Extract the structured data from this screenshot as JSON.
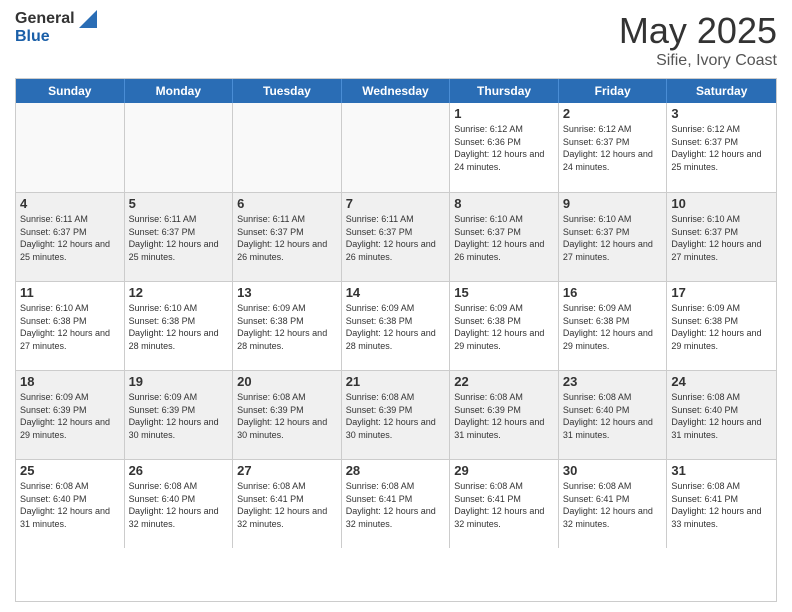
{
  "header": {
    "logo_general": "General",
    "logo_blue": "Blue",
    "month_title": "May 2025",
    "location": "Sifie, Ivory Coast"
  },
  "days_of_week": [
    "Sunday",
    "Monday",
    "Tuesday",
    "Wednesday",
    "Thursday",
    "Friday",
    "Saturday"
  ],
  "weeks": [
    [
      {
        "day": "",
        "empty": true
      },
      {
        "day": "",
        "empty": true
      },
      {
        "day": "",
        "empty": true
      },
      {
        "day": "",
        "empty": true
      },
      {
        "day": "1",
        "sunrise": "6:12 AM",
        "sunset": "6:36 PM",
        "daylight": "12 hours and 24 minutes."
      },
      {
        "day": "2",
        "sunrise": "6:12 AM",
        "sunset": "6:37 PM",
        "daylight": "12 hours and 24 minutes."
      },
      {
        "day": "3",
        "sunrise": "6:12 AM",
        "sunset": "6:37 PM",
        "daylight": "12 hours and 25 minutes."
      }
    ],
    [
      {
        "day": "4",
        "sunrise": "6:11 AM",
        "sunset": "6:37 PM",
        "daylight": "12 hours and 25 minutes."
      },
      {
        "day": "5",
        "sunrise": "6:11 AM",
        "sunset": "6:37 PM",
        "daylight": "12 hours and 25 minutes."
      },
      {
        "day": "6",
        "sunrise": "6:11 AM",
        "sunset": "6:37 PM",
        "daylight": "12 hours and 26 minutes."
      },
      {
        "day": "7",
        "sunrise": "6:11 AM",
        "sunset": "6:37 PM",
        "daylight": "12 hours and 26 minutes."
      },
      {
        "day": "8",
        "sunrise": "6:10 AM",
        "sunset": "6:37 PM",
        "daylight": "12 hours and 26 minutes."
      },
      {
        "day": "9",
        "sunrise": "6:10 AM",
        "sunset": "6:37 PM",
        "daylight": "12 hours and 27 minutes."
      },
      {
        "day": "10",
        "sunrise": "6:10 AM",
        "sunset": "6:37 PM",
        "daylight": "12 hours and 27 minutes."
      }
    ],
    [
      {
        "day": "11",
        "sunrise": "6:10 AM",
        "sunset": "6:38 PM",
        "daylight": "12 hours and 27 minutes."
      },
      {
        "day": "12",
        "sunrise": "6:10 AM",
        "sunset": "6:38 PM",
        "daylight": "12 hours and 28 minutes."
      },
      {
        "day": "13",
        "sunrise": "6:09 AM",
        "sunset": "6:38 PM",
        "daylight": "12 hours and 28 minutes."
      },
      {
        "day": "14",
        "sunrise": "6:09 AM",
        "sunset": "6:38 PM",
        "daylight": "12 hours and 28 minutes."
      },
      {
        "day": "15",
        "sunrise": "6:09 AM",
        "sunset": "6:38 PM",
        "daylight": "12 hours and 29 minutes."
      },
      {
        "day": "16",
        "sunrise": "6:09 AM",
        "sunset": "6:38 PM",
        "daylight": "12 hours and 29 minutes."
      },
      {
        "day": "17",
        "sunrise": "6:09 AM",
        "sunset": "6:38 PM",
        "daylight": "12 hours and 29 minutes."
      }
    ],
    [
      {
        "day": "18",
        "sunrise": "6:09 AM",
        "sunset": "6:39 PM",
        "daylight": "12 hours and 29 minutes."
      },
      {
        "day": "19",
        "sunrise": "6:09 AM",
        "sunset": "6:39 PM",
        "daylight": "12 hours and 30 minutes."
      },
      {
        "day": "20",
        "sunrise": "6:08 AM",
        "sunset": "6:39 PM",
        "daylight": "12 hours and 30 minutes."
      },
      {
        "day": "21",
        "sunrise": "6:08 AM",
        "sunset": "6:39 PM",
        "daylight": "12 hours and 30 minutes."
      },
      {
        "day": "22",
        "sunrise": "6:08 AM",
        "sunset": "6:39 PM",
        "daylight": "12 hours and 31 minutes."
      },
      {
        "day": "23",
        "sunrise": "6:08 AM",
        "sunset": "6:40 PM",
        "daylight": "12 hours and 31 minutes."
      },
      {
        "day": "24",
        "sunrise": "6:08 AM",
        "sunset": "6:40 PM",
        "daylight": "12 hours and 31 minutes."
      }
    ],
    [
      {
        "day": "25",
        "sunrise": "6:08 AM",
        "sunset": "6:40 PM",
        "daylight": "12 hours and 31 minutes."
      },
      {
        "day": "26",
        "sunrise": "6:08 AM",
        "sunset": "6:40 PM",
        "daylight": "12 hours and 32 minutes."
      },
      {
        "day": "27",
        "sunrise": "6:08 AM",
        "sunset": "6:41 PM",
        "daylight": "12 hours and 32 minutes."
      },
      {
        "day": "28",
        "sunrise": "6:08 AM",
        "sunset": "6:41 PM",
        "daylight": "12 hours and 32 minutes."
      },
      {
        "day": "29",
        "sunrise": "6:08 AM",
        "sunset": "6:41 PM",
        "daylight": "12 hours and 32 minutes."
      },
      {
        "day": "30",
        "sunrise": "6:08 AM",
        "sunset": "6:41 PM",
        "daylight": "12 hours and 32 minutes."
      },
      {
        "day": "31",
        "sunrise": "6:08 AM",
        "sunset": "6:41 PM",
        "daylight": "12 hours and 33 minutes."
      }
    ]
  ]
}
